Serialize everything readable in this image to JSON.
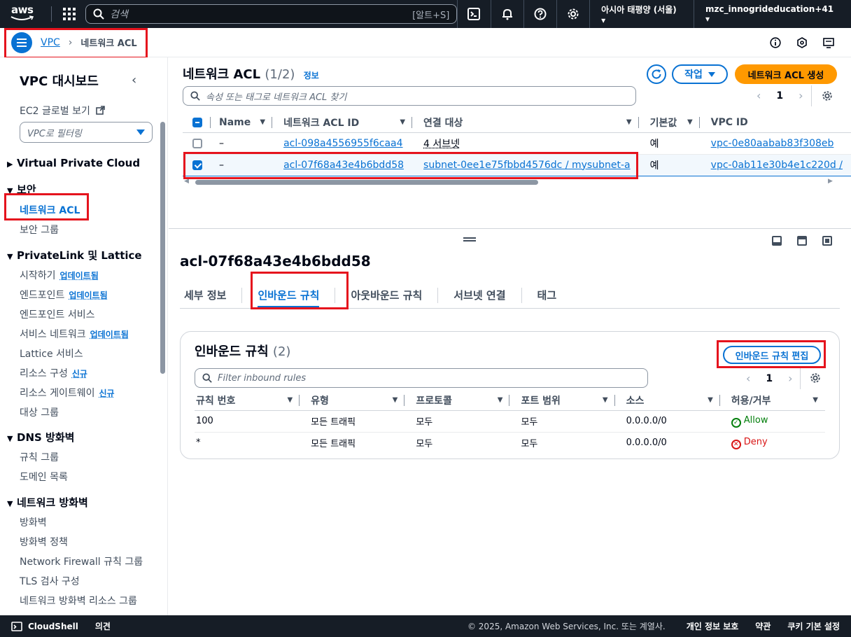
{
  "topnav": {
    "logo": "aws",
    "search_placeholder": "검색",
    "search_shortcut": "[알트+S]",
    "region": "아시아 태평양 (서울) ▾",
    "account": "mzc_innogrideducation+41 ▾",
    "icons": [
      "grid-icon",
      "search-icon",
      "cloudshell-icon",
      "bell-icon",
      "help-icon",
      "gear-icon"
    ]
  },
  "breadcrumb": {
    "root": "VPC",
    "current": "네트워크 ACL"
  },
  "sidebar": {
    "title": "VPC 대시보드",
    "ec2_global": "EC2 글로벌 보기",
    "filter_placeholder": "VPC로 필터링",
    "sections": {
      "vpc": "Virtual Private Cloud",
      "security": "보안",
      "privatelink": "PrivateLink 및 Lattice",
      "dns": "DNS 방화벽",
      "netfw": "네트워크 방화벽"
    },
    "items": {
      "network_acl": "네트워크 ACL",
      "security_group": "보안 그룹",
      "getting_started": "시작하기",
      "endpoints": "엔드포인트",
      "endpoint_services": "엔드포인트 서비스",
      "service_networks": "서비스 네트워크",
      "lattice_services": "Lattice 서비스",
      "resource_config": "리소스 구성",
      "resource_gateway": "리소스 게이트웨이",
      "target_groups": "대상 그룹",
      "rule_groups": "규칙 그룹",
      "domain_lists": "도메인 목록",
      "firewalls": "방화벽",
      "firewall_policies": "방화벽 정책",
      "nf_rule_groups": "Network Firewall 규칙 그룹",
      "tls_inspection": "TLS 검사 구성",
      "nf_resource_groups": "네트워크 방화벽 리소스 그룹"
    },
    "badges": {
      "updated": "업데이트됨",
      "new": "신규"
    }
  },
  "acl_list": {
    "title": "네트워크 ACL",
    "count": "(1/2)",
    "info": "정보",
    "action_label": "작업",
    "create_label": "네트워크 ACL 생성",
    "search_placeholder": "속성 또는 태그로 네트워크 ACL 찾기",
    "page": "1",
    "columns": [
      "Name",
      "네트워크 ACL ID",
      "연결 대상",
      "기본값",
      "VPC ID"
    ],
    "rows": [
      {
        "name": "–",
        "id": "acl-098a4556955f6caa4",
        "assoc": "4 서브넷",
        "default": "예",
        "vpc": "vpc-0e80aabab83f308eb",
        "selected": false
      },
      {
        "name": "–",
        "id": "acl-07f68a43e4b6bdd58",
        "assoc": "subnet-0ee1e75fbbd4576dc / mysubnet-a",
        "default": "예",
        "vpc": "vpc-0ab11e30b4e1c220d /",
        "selected": true
      }
    ]
  },
  "detail": {
    "title": "acl-07f68a43e4b6bdd58",
    "tabs": [
      "세부 정보",
      "인바운드 규칙",
      "아웃바운드 규칙",
      "서브넷 연결",
      "태그"
    ],
    "active_tab": 1,
    "rules_title": "인바운드 규칙",
    "rules_count": "(2)",
    "edit_label": "인바운드 규칙 편집",
    "rules_search_placeholder": "Filter inbound rules",
    "page": "1",
    "columns": [
      "규칙 번호",
      "유형",
      "프로토콜",
      "포트 범위",
      "소스",
      "허용/거부"
    ],
    "rules": [
      {
        "num": "100",
        "type": "모든 트래픽",
        "protocol": "모두",
        "port": "모두",
        "source": "0.0.0.0/0",
        "action": "Allow"
      },
      {
        "num": "*",
        "type": "모든 트래픽",
        "protocol": "모두",
        "port": "모두",
        "source": "0.0.0.0/0",
        "action": "Deny"
      }
    ]
  },
  "footer": {
    "cloudshell": "CloudShell",
    "feedback": "의견",
    "copyright": "© 2025, Amazon Web Services, Inc. 또는 계열사.",
    "privacy": "개인 정보 보호",
    "terms": "약관",
    "cookies": "쿠키 기본 설정"
  },
  "colors": {
    "accent": "#0972d3",
    "primary_button": "#ff9900",
    "nav_bg": "#161d26",
    "highlight_box": "#e5131d",
    "allow": "#037f0c",
    "deny": "#d91515"
  }
}
